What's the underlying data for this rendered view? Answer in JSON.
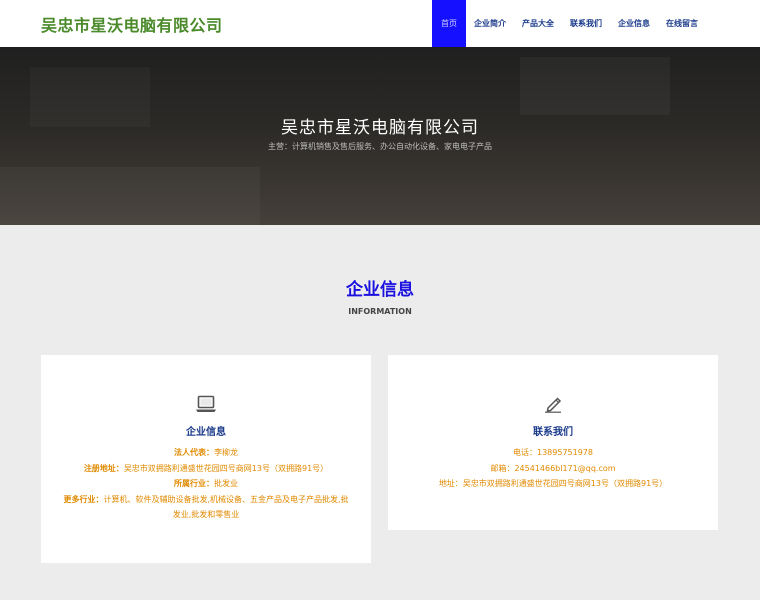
{
  "header": {
    "logo": "吴忠市星沃电脑有限公司",
    "nav": [
      "首页",
      "企业简介",
      "产品大全",
      "联系我们",
      "企业信息",
      "在线留言"
    ]
  },
  "hero": {
    "title": "吴忠市星沃电脑有限公司",
    "subtitle": "主营：计算机销售及售后服务、办公自动化设备、家电电子产品"
  },
  "section": {
    "title": "企业信息",
    "subtitle": "INFORMATION"
  },
  "info_card": {
    "icon": "laptop-icon",
    "title": "企业信息",
    "legal_label": "法人代表：",
    "legal_value": "李柳龙",
    "address_label": "注册地址：",
    "address_value": "吴忠市双拥路利通盛世花园四号商网13号（双拥路91号）",
    "industry_label": "所属行业：",
    "industry_value": "批发业",
    "more_label": "更多行业：",
    "more_value": "计算机、软件及辅助设备批发,机械设备、五金产品及电子产品批发,批发业,批发和零售业"
  },
  "contact_card": {
    "icon": "pencil-icon",
    "title": "联系我们",
    "phone": "电话：13895751978",
    "email": "邮箱：24541466bl171@qq.com",
    "address": "地址：吴忠市双拥路利通盛世花园四号商网13号（双拥路91号）"
  }
}
